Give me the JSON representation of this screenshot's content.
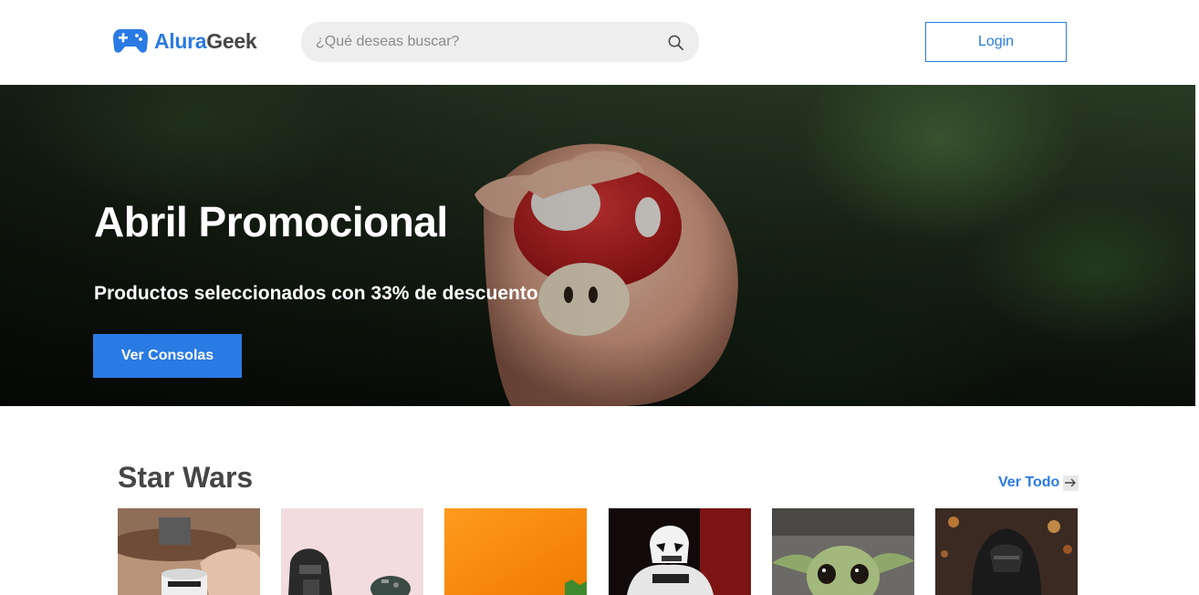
{
  "header": {
    "logo_part1": "Alura",
    "logo_part2": "Geek",
    "search_placeholder": "¿Qué deseas buscar?",
    "login_label": "Login"
  },
  "hero": {
    "title": "Abril Promocional",
    "subtitle": "Productos seleccionados con 33% de descuento",
    "button_label": "Ver Consolas"
  },
  "section": {
    "title": "Star Wars",
    "view_all_label": "Ver Todo"
  },
  "products": [
    {
      "image": "stormtrooper-mug-photo"
    },
    {
      "image": "lego-darth-vader-photo"
    },
    {
      "image": "yoda-orange-photo"
    },
    {
      "image": "stormtrooper-figure-photo"
    },
    {
      "image": "baby-yoda-photo"
    },
    {
      "image": "kylo-ren-photo"
    }
  ],
  "colors": {
    "accent": "#2a7ae4",
    "text": "#464646",
    "search_bg": "#eeeeee"
  }
}
